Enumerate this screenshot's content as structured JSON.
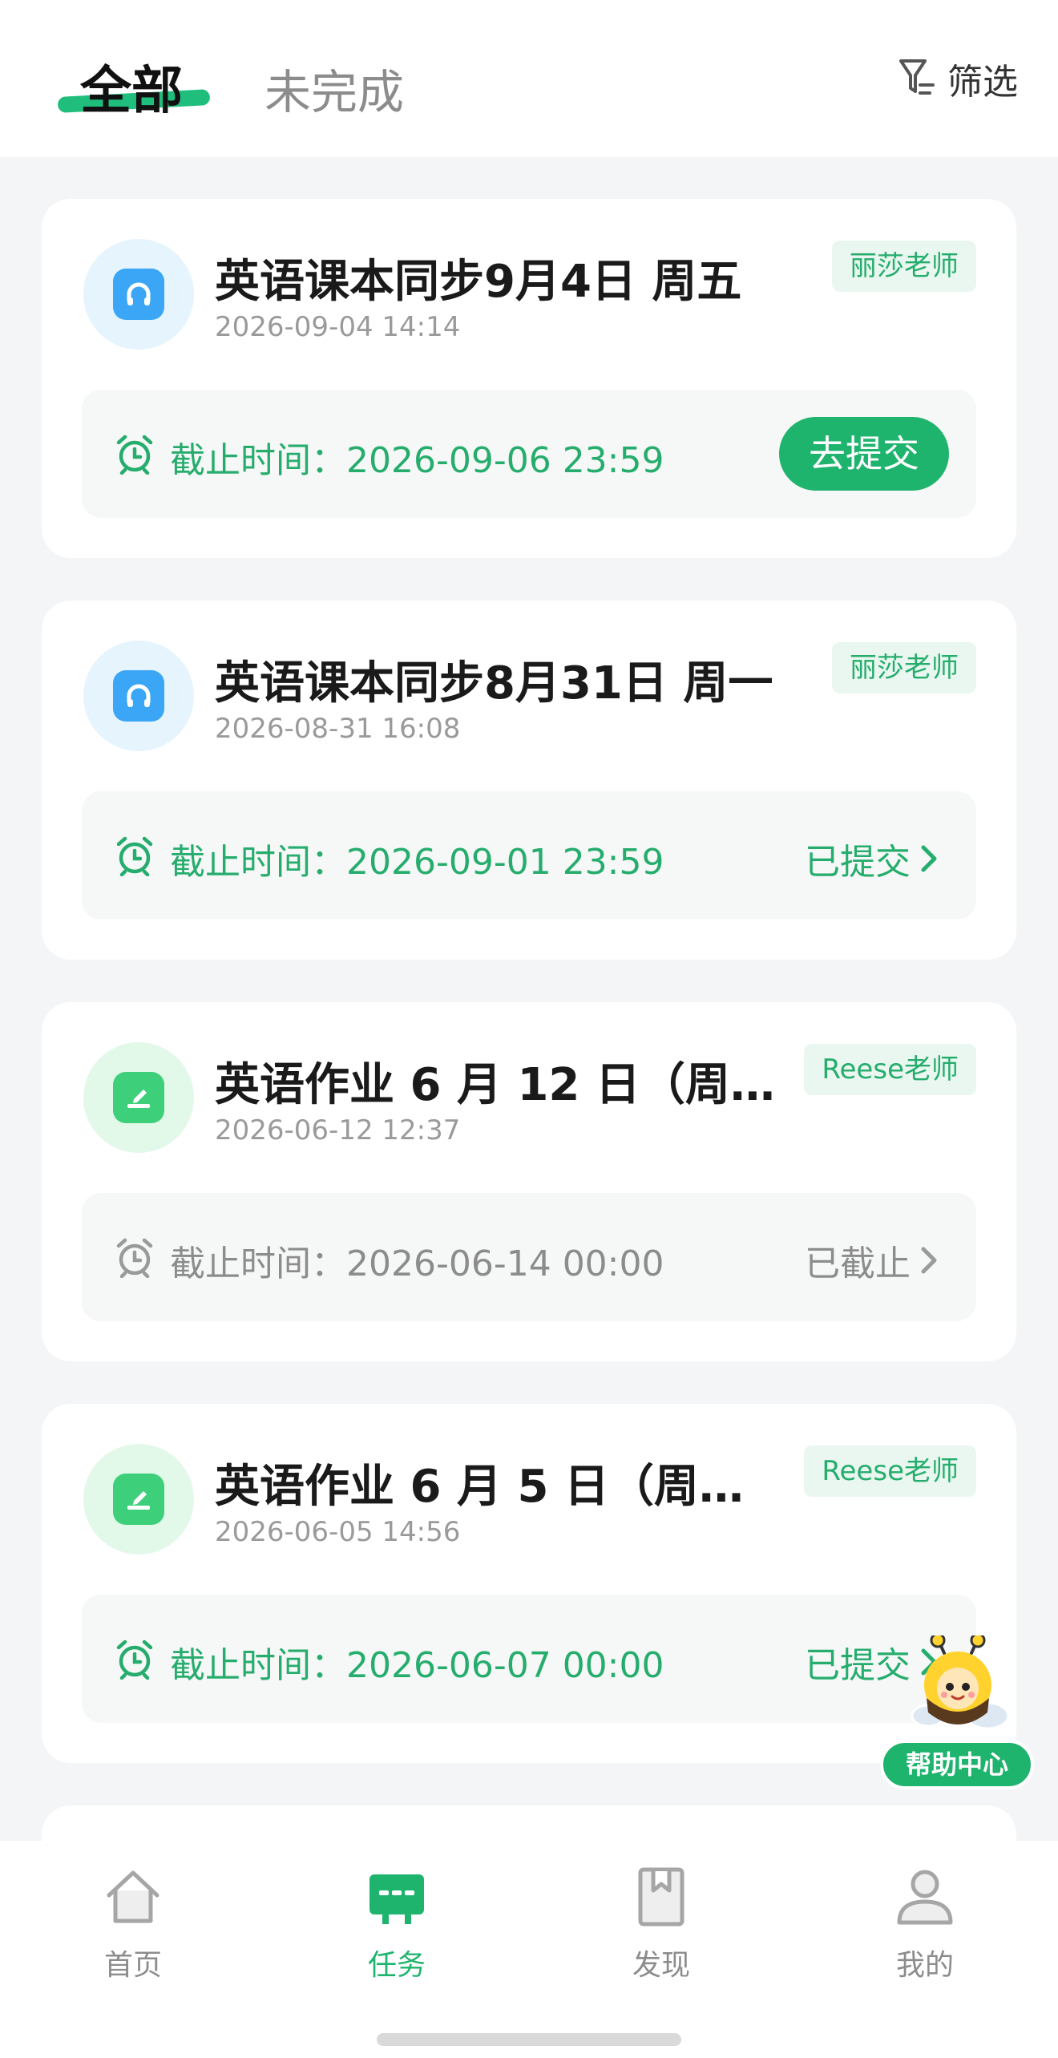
{
  "header": {
    "tab_all": "全部",
    "tab_incomplete": "未完成",
    "filter_label": "筛选"
  },
  "tasks": [
    {
      "title": "英语课本同步9月4日 周五",
      "date": "2026-09-04 14:14",
      "teacher": "丽莎老师",
      "deadline": "截止时间：2026-09-06 23:59",
      "action": "去提交",
      "icon": "headphone-book-icon"
    },
    {
      "title": "英语课本同步8月31日 周一",
      "date": "2026-08-31 16:08",
      "teacher": "丽莎老师",
      "deadline": "截止时间：2026-09-01 23:59",
      "status": "已提交",
      "icon": "headphone-book-icon"
    },
    {
      "title": "英语作业 6 月 12 日（周…",
      "date": "2026-06-12 12:37",
      "teacher": "Reese老师",
      "deadline": "截止时间：2026-06-14 00:00",
      "status": "已截止",
      "icon": "homework-book-icon"
    },
    {
      "title": "英语作业 6 月 5 日（周…",
      "date": "2026-06-05 14:56",
      "teacher": "Reese老师",
      "deadline": "截止时间：2026-06-07 00:00",
      "status": "已提交",
      "icon": "homework-book-icon"
    }
  ],
  "helper": {
    "label": "帮助中心"
  },
  "nav": [
    {
      "label": "首页",
      "icon": "home-icon"
    },
    {
      "label": "任务",
      "icon": "task-icon",
      "active": true
    },
    {
      "label": "发现",
      "icon": "bookmark-icon"
    },
    {
      "label": "我的",
      "icon": "profile-icon"
    }
  ],
  "colors": {
    "accent": "#1fb46e",
    "accent_text": "#26ad6d",
    "muted": "#8c8c8c"
  }
}
